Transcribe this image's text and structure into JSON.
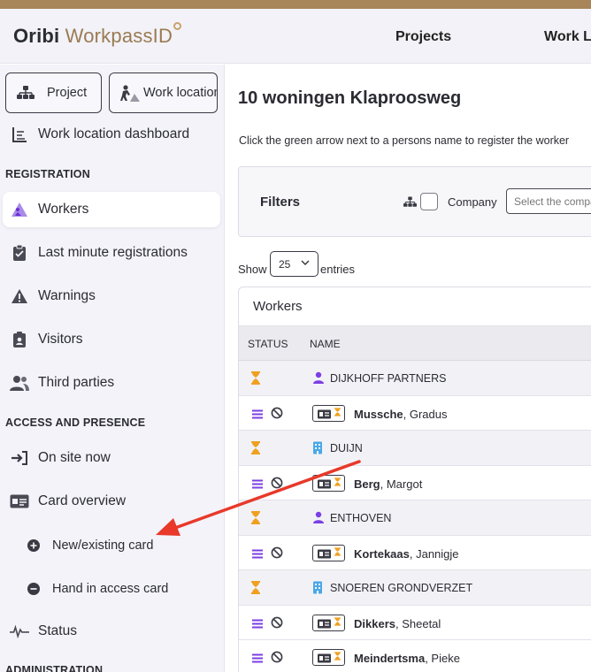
{
  "header": {
    "logo_bold": "Oribi",
    "logo_light": "WorkpassID",
    "nav": [
      "Projects",
      "Work Lo"
    ]
  },
  "sidebar": {
    "project_button": "Project",
    "work_location_button": "Work location",
    "dashboard": "Work location dashboard",
    "sections": {
      "registration": "REGISTRATION",
      "access": "ACCESS AND PRESENCE",
      "administration": "ADMINISTRATION"
    },
    "registration_items": [
      "Workers",
      "Last minute registrations",
      "Warnings",
      "Visitors",
      "Third parties"
    ],
    "access_items": [
      "On site now",
      "Card overview"
    ],
    "card_sub_items": [
      "New/existing card",
      "Hand in access card"
    ],
    "status_item": "Status"
  },
  "main": {
    "title": "10 woningen Klaproosweg",
    "instruction": "Click the green arrow next to a persons name to register the worker",
    "filters": {
      "label": "Filters",
      "company_label": "Company",
      "company_placeholder": "Select the company"
    },
    "show_label": "Show",
    "entries_value": "25",
    "entries_label": "entries",
    "table": {
      "card_title": "Workers",
      "columns": [
        "STATUS",
        "NAME"
      ],
      "rows": [
        {
          "type": "group",
          "icon": "person-icon",
          "name": "DIJKHOFF PARTNERS"
        },
        {
          "type": "person",
          "last": "Mussche",
          "first": ", Gradus"
        },
        {
          "type": "group",
          "icon": "building-icon",
          "name": "DUIJN"
        },
        {
          "type": "person",
          "last": "Berg",
          "first": ", Margot"
        },
        {
          "type": "group",
          "icon": "person-icon",
          "name": "ENTHOVEN"
        },
        {
          "type": "person",
          "last": "Kortekaas",
          "first": ", Jannigje"
        },
        {
          "type": "group",
          "icon": "building-icon",
          "name": "SNOEREN GRONDVERZET"
        },
        {
          "type": "person",
          "last": "Dikkers",
          "first": ", Sheetal"
        },
        {
          "type": "person",
          "last": "Meindertsma",
          "first": ", Pieke"
        }
      ]
    }
  },
  "colors": {
    "accent_purple": "#7b3fe4",
    "hourglass_orange": "#f0a020",
    "building_blue": "#4aa8e8",
    "annotation_arrow": "#e8392a",
    "brand_gold": "#a8865a"
  }
}
